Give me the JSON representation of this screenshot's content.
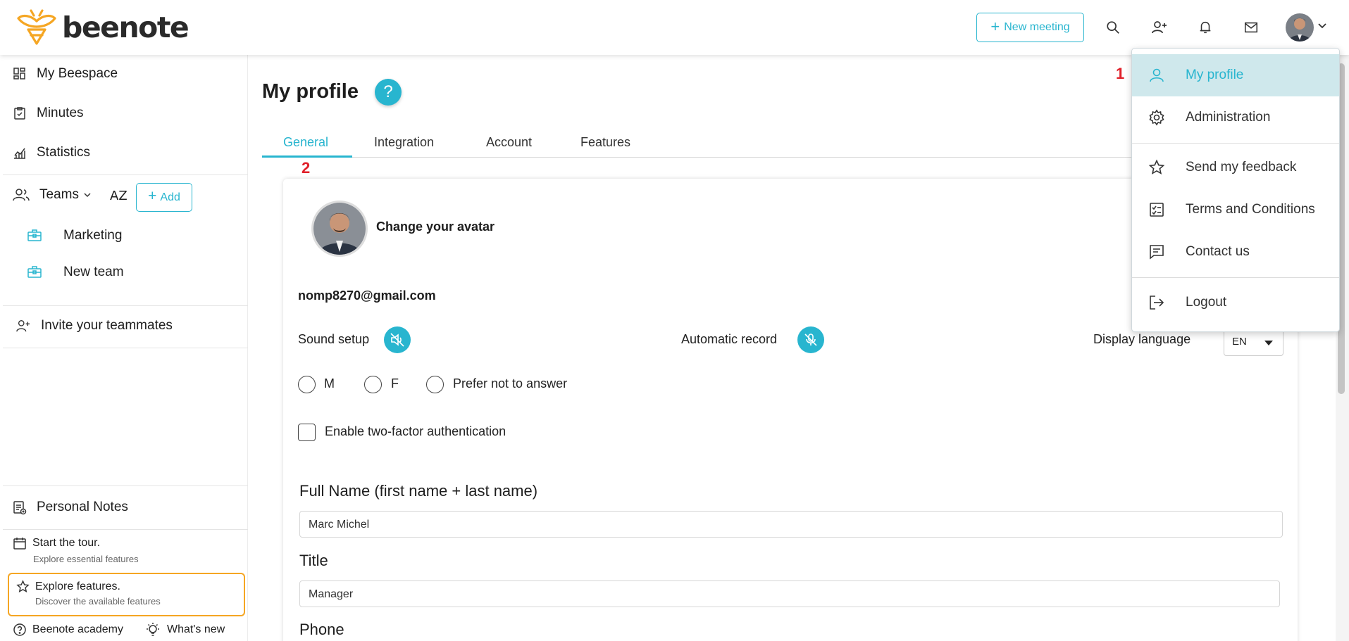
{
  "header": {
    "logo_text": "beenote",
    "new_meeting_label": "New meeting"
  },
  "sidebar": {
    "items": [
      {
        "label": "My Beespace"
      },
      {
        "label": "Minutes"
      },
      {
        "label": "Statistics"
      }
    ],
    "teams_label": "Teams",
    "sort_label": "AZ",
    "add_label": "Add",
    "teams": [
      {
        "label": "Marketing"
      },
      {
        "label": "New team"
      }
    ],
    "invite_label": "Invite your teammates",
    "personal_notes_label": "Personal Notes",
    "tour": {
      "title": "Start the tour.",
      "subtitle": "Explore essential features"
    },
    "explore": {
      "title": "Explore features.",
      "subtitle": "Discover the available features"
    },
    "academy_label": "Beenote academy",
    "whats_new_label": "What's new"
  },
  "main": {
    "title": "My profile",
    "help_label": "?",
    "tabs": [
      {
        "label": "General"
      },
      {
        "label": "Integration"
      },
      {
        "label": "Account"
      },
      {
        "label": "Features"
      }
    ],
    "step_marker_1": "1",
    "step_marker_2": "2",
    "change_avatar_label": "Change your avatar",
    "email": "nomp8270@gmail.com",
    "sound_setup_label": "Sound setup",
    "automatic_record_label": "Automatic record",
    "display_language_label": "Display language",
    "display_language_value": "EN",
    "gender_options": [
      "M",
      "F",
      "Prefer not to answer"
    ],
    "two_factor_label": "Enable two-factor authentication",
    "full_name_label": "Full Name (first name + last name)",
    "full_name_value": "Marc Michel",
    "title_label": "Title",
    "title_value": "Manager",
    "phone_label": "Phone"
  },
  "user_menu": {
    "items": [
      {
        "label": "My profile"
      },
      {
        "label": "Administration"
      },
      {
        "label": "Send my feedback"
      },
      {
        "label": "Terms and Conditions"
      },
      {
        "label": "Contact us"
      },
      {
        "label": "Logout"
      }
    ]
  },
  "colors": {
    "accent": "#28b5cf",
    "highlight_border": "#f5a623",
    "step_marker": "#e0202a"
  }
}
